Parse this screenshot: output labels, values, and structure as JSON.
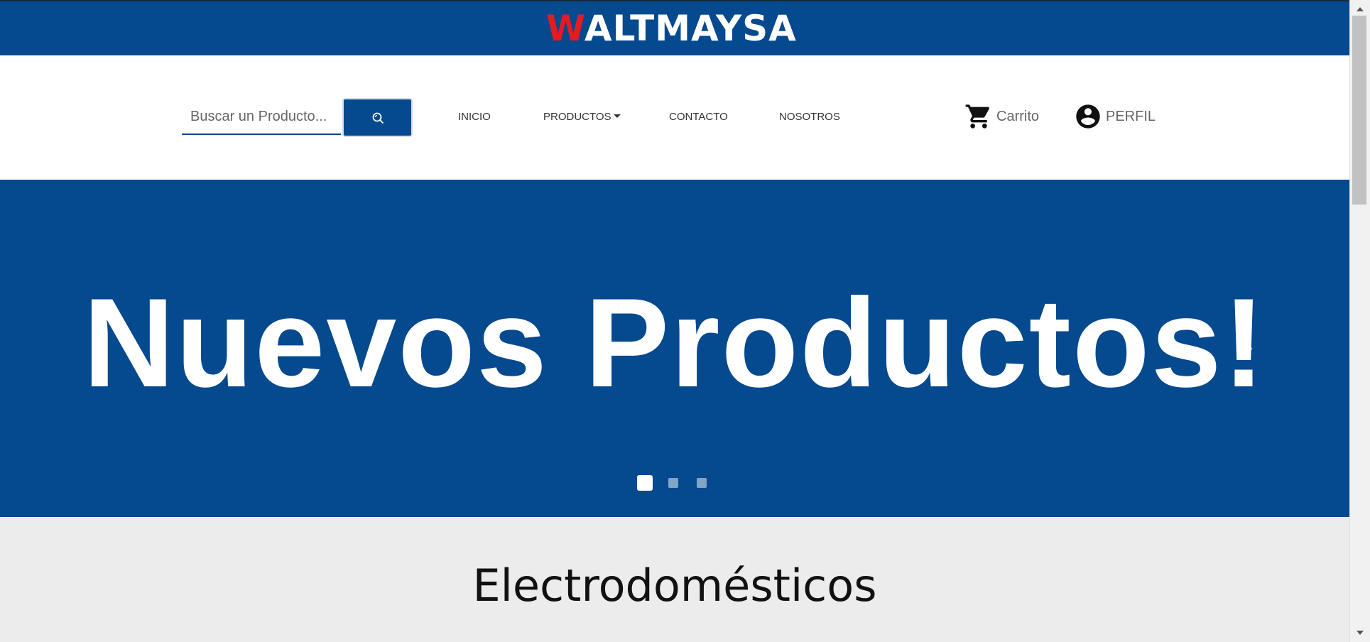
{
  "brand": {
    "logo_first": "W",
    "logo_rest": "ALTMAYSA",
    "bar_color": "#05498f",
    "accent_color": "#e31b23"
  },
  "search": {
    "placeholder": "Buscar un Producto...",
    "value": "",
    "button_icon": "search-icon"
  },
  "nav": {
    "items": [
      {
        "label": "INICIO"
      },
      {
        "label": "PRODUCTOS",
        "has_dropdown": true
      },
      {
        "label": "CONTACTO"
      },
      {
        "label": "NOSOTROS"
      }
    ],
    "cart_label": "Carrito",
    "cart_icon": "cart-icon",
    "profile_label": "PERFIL",
    "profile_icon": "account-circle-icon"
  },
  "hero": {
    "title": "Nuevos Productos!",
    "background_color": "#05498f",
    "prev_icon": "chevron-left-icon",
    "next_icon": "chevron-right-icon",
    "slides_count": 3,
    "active_slide": 1
  },
  "section": {
    "title": "Electrodomésticos"
  }
}
